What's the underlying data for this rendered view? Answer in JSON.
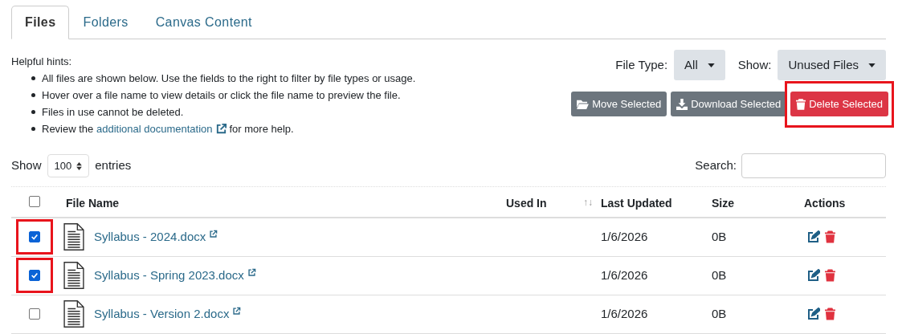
{
  "tabs": [
    {
      "label": "Files",
      "selected": true
    },
    {
      "label": "Folders",
      "selected": false
    },
    {
      "label": "Canvas Content",
      "selected": false
    }
  ],
  "hints": {
    "title": "Helpful hints:",
    "items": [
      {
        "kind": "text",
        "text": "All files are shown below. Use the fields to the right to filter by file types or usage."
      },
      {
        "kind": "text",
        "text": "Hover over a file name to view details or click the file name to preview the file."
      },
      {
        "kind": "text",
        "text": "Files in use cannot be deleted."
      },
      {
        "kind": "link",
        "before": "Review the",
        "link": "additional documentation",
        "after": "for more help."
      }
    ]
  },
  "filters": [
    {
      "label": "File Type:",
      "value": "All"
    },
    {
      "label": "Show:",
      "value": "Unused Files"
    }
  ],
  "actions": [
    {
      "kind": "move",
      "label": "Move Selected",
      "highlighted": false
    },
    {
      "kind": "download",
      "label": "Download Selected",
      "highlighted": false
    },
    {
      "kind": "delete",
      "label": "Delete Selected",
      "highlighted": true
    }
  ],
  "length": {
    "before": "Show",
    "value": "100",
    "after": "entries"
  },
  "search": {
    "label": "Search:"
  },
  "table": {
    "select_all_checked": false,
    "checkboxes_highlighted": true,
    "columns": [
      "File Name",
      "Used In",
      "Last Updated",
      "Size",
      "Actions"
    ],
    "sort_indicator": "↑↓",
    "rows": [
      {
        "checked": true,
        "name": "Syllabus - 2024.docx",
        "used_in": "",
        "updated": "1/6/2026",
        "size": "0B"
      },
      {
        "checked": true,
        "name": "Syllabus - Spring 2023.docx",
        "used_in": "",
        "updated": "1/6/2026",
        "size": "0B"
      },
      {
        "checked": false,
        "name": "Syllabus - Version 2.docx",
        "used_in": "",
        "updated": "1/6/2026",
        "size": "0B"
      }
    ]
  }
}
